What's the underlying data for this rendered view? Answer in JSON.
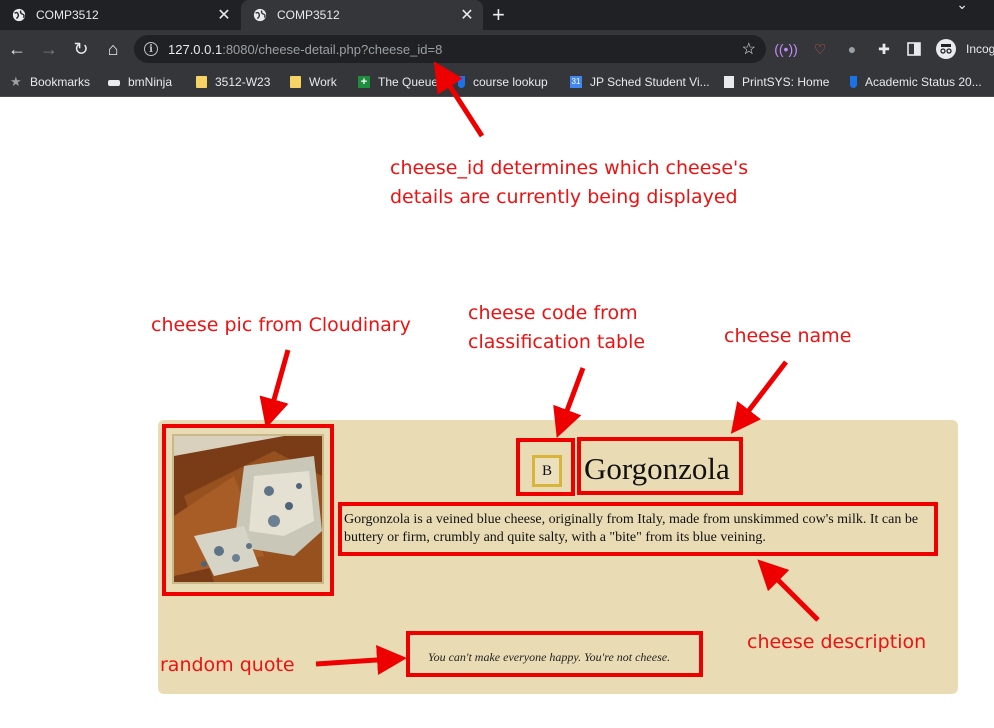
{
  "tabs": [
    {
      "title": "COMP3512"
    },
    {
      "title": "COMP3512"
    }
  ],
  "omnibox": {
    "host": "127.0.0.1",
    "rest": ":8080/cheese-detail.php?cheese_id=8"
  },
  "profile": {
    "label": "Incog"
  },
  "bookmarks": [
    {
      "label": "Bookmarks",
      "icon": "star-icon"
    },
    {
      "label": "bmNinja",
      "icon": "ninja-icon"
    },
    {
      "label": "3512-W23",
      "icon": "folder-icon"
    },
    {
      "label": "Work",
      "icon": "folder-icon"
    },
    {
      "label": "The Queue",
      "icon": "plus-sheet-icon"
    },
    {
      "label": "course lookup",
      "icon": "shield-icon"
    },
    {
      "label": "JP Sched Student Vi...",
      "icon": "calendar-icon"
    },
    {
      "label": "PrintSYS: Home",
      "icon": "doc-icon"
    },
    {
      "label": "Academic Status 20...",
      "icon": "shield-icon"
    }
  ],
  "cheese": {
    "code": "B",
    "name": "Gorgonzola",
    "description": "Gorgonzola is a veined blue cheese, originally from Italy, made from unskimmed cow's milk. It can be buttery or firm, crumbly and quite salty, with a \"bite\" from its blue veining.",
    "quote": "You can't make everyone happy. You're not cheese."
  },
  "annotations": {
    "cheese_id_line1": "cheese_id determines which cheese's",
    "cheese_id_line2": "details are currently being displayed",
    "pic": "cheese pic from Cloudinary",
    "code_line1": "cheese code from",
    "code_line2": "classification table",
    "name": "cheese name",
    "description": "cheese description",
    "quote": "random quote"
  },
  "colors": {
    "annotation_red": "#ee1111",
    "card_background": "#e9dcb4",
    "code_border": "#d8b43a",
    "chrome_dark": "#202124",
    "chrome_toolbar": "#35363a"
  }
}
